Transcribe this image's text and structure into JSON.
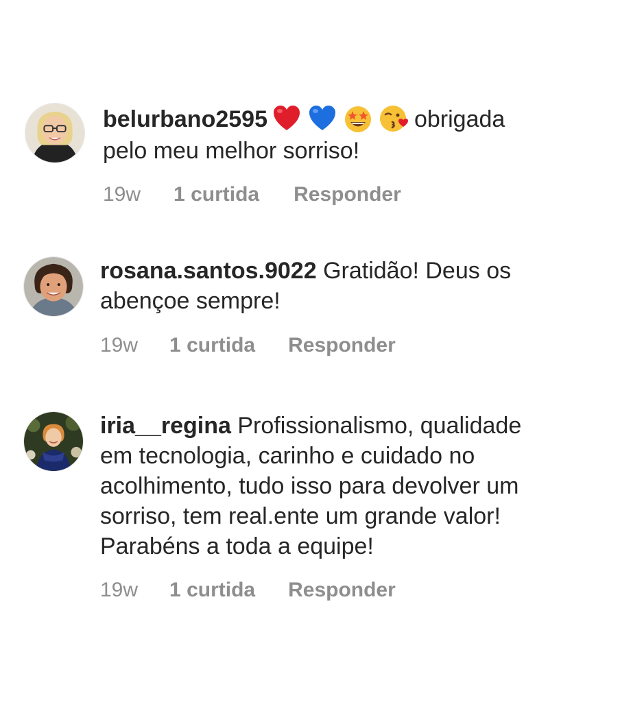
{
  "comments": [
    {
      "username": "belurbano2595",
      "emojis": [
        "red-heart-icon",
        "blue-heart-icon",
        "star-struck-face-icon",
        "face-blowing-kiss-icon"
      ],
      "text_line1": "obrigada",
      "text_line2": "pelo meu melhor sorriso!",
      "time": "19w",
      "likes": "1 curtida",
      "reply": "Responder"
    },
    {
      "username": "rosana.santos.9022",
      "text_line1": "Gratidão! Deus os",
      "text_line2": "abençoe sempre!",
      "time": "19w",
      "likes": "1 curtida",
      "reply": "Responder"
    },
    {
      "username": "iria__regina",
      "text_line1": "Profissionalismo, qualidade",
      "text_line2": "em tecnologia, carinho e cuidado no",
      "text_line3": "acolhimento, tudo isso para devolver um",
      "text_line4": "sorriso, tem real.ente um grande valor!",
      "text_line5": "Parabéns a toda a equipe!",
      "time": "19w",
      "likes": "1 curtida",
      "reply": "Responder"
    }
  ],
  "colors": {
    "text": "#262626",
    "meta": "#8e8e8e",
    "background": "#ffffff"
  }
}
